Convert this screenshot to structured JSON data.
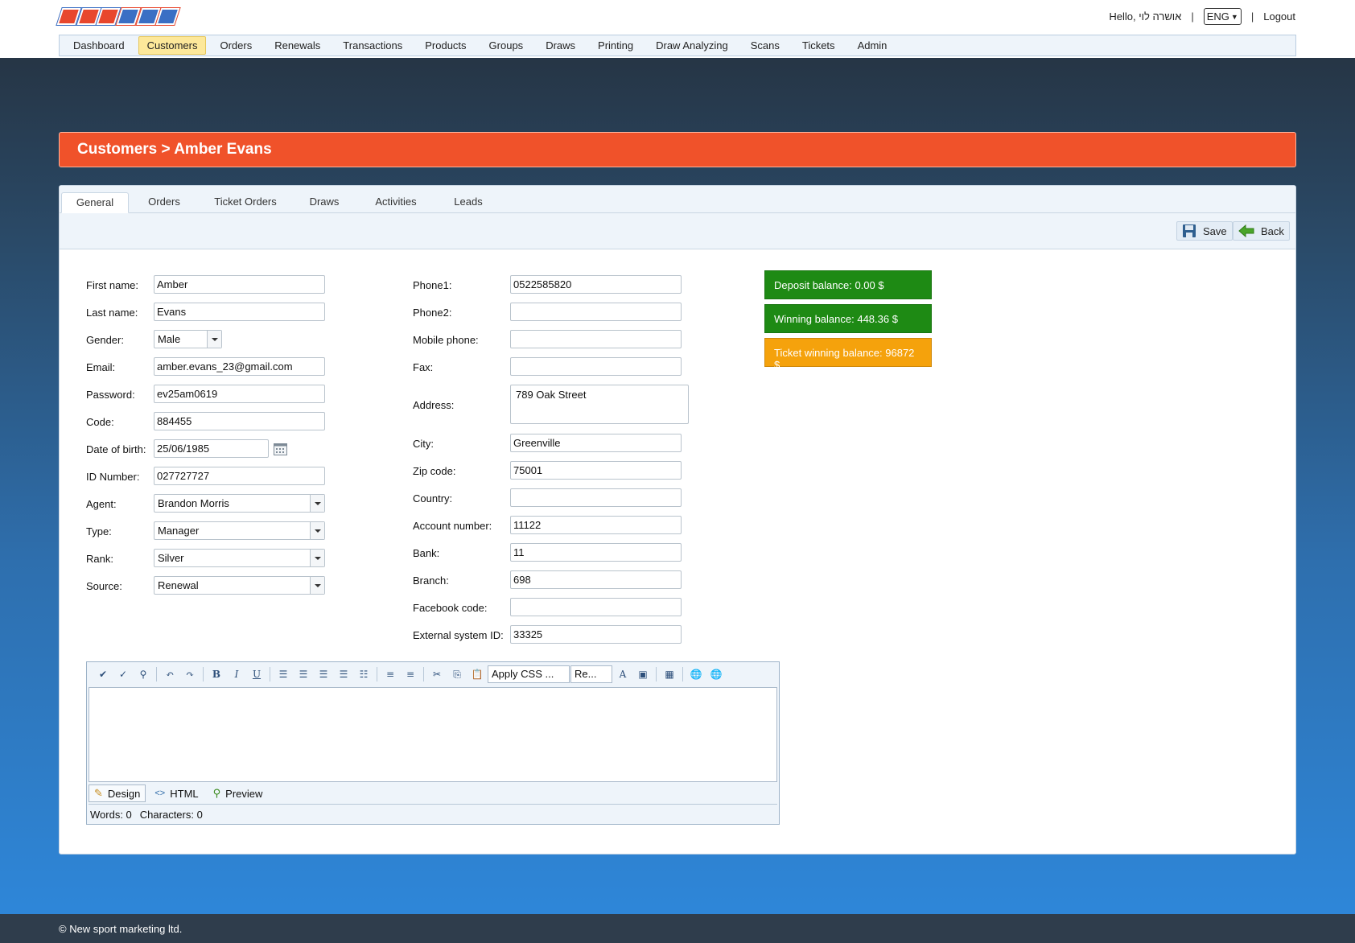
{
  "header": {
    "greeting": "Hello, אושרה לוי",
    "separator": "|",
    "language": "ENG",
    "logout": "Logout"
  },
  "nav": {
    "items": [
      "Dashboard",
      "Customers",
      "Orders",
      "Renewals",
      "Transactions",
      "Products",
      "Groups",
      "Draws",
      "Printing",
      "Draw Analyzing",
      "Scans",
      "Tickets",
      "Admin"
    ],
    "active": "Customers"
  },
  "page": {
    "title": "Customers > Amber Evans"
  },
  "tabs": {
    "items": [
      "General",
      "Orders",
      "Ticket Orders",
      "Draws",
      "Activities",
      "Leads"
    ],
    "active": "General"
  },
  "toolbar": {
    "save": "Save",
    "back": "Back"
  },
  "form": {
    "first_name": {
      "label": "First name:",
      "value": "Amber"
    },
    "last_name": {
      "label": "Last name:",
      "value": "Evans"
    },
    "gender": {
      "label": "Gender:",
      "value": "Male"
    },
    "email": {
      "label": "Email:",
      "value": "amber.evans_23@gmail.com"
    },
    "password": {
      "label": "Password:",
      "value": "ev25am0619"
    },
    "code": {
      "label": "Code:",
      "value": "884455"
    },
    "dob": {
      "label": "Date of birth:",
      "value": "25/06/1985"
    },
    "id_number": {
      "label": "ID Number:",
      "value": "027727727"
    },
    "agent": {
      "label": "Agent:",
      "value": "Brandon Morris"
    },
    "type": {
      "label": "Type:",
      "value": "Manager"
    },
    "rank": {
      "label": "Rank:",
      "value": "Silver"
    },
    "source": {
      "label": "Source:",
      "value": "Renewal"
    },
    "phone1": {
      "label": "Phone1:",
      "value": "0522585820"
    },
    "phone2": {
      "label": "Phone2:",
      "value": ""
    },
    "mobile": {
      "label": "Mobile phone:",
      "value": ""
    },
    "fax": {
      "label": "Fax:",
      "value": ""
    },
    "address": {
      "label": "Address:",
      "value": "789 Oak Street"
    },
    "city": {
      "label": "City:",
      "value": "Greenville"
    },
    "zip": {
      "label": "Zip code:",
      "value": "75001"
    },
    "country": {
      "label": "Country:",
      "value": ""
    },
    "account": {
      "label": "Account number:",
      "value": "11122"
    },
    "bank": {
      "label": "Bank:",
      "value": "11"
    },
    "branch": {
      "label": "Branch:",
      "value": "698"
    },
    "facebook": {
      "label": "Facebook code:",
      "value": ""
    },
    "external_id": {
      "label": "External system ID:",
      "value": "33325"
    }
  },
  "balances": {
    "deposit": {
      "text": "Deposit balance: 0.00 $",
      "color": "#1e8a14"
    },
    "winning": {
      "text": "Winning balance: 448.36 $",
      "color": "#1e8a14"
    },
    "ticket": {
      "text": "Ticket winning balance: 96872 $",
      "color": "#f5a20c"
    }
  },
  "editor": {
    "css_dropdown": "Apply CSS ...",
    "format_dropdown": "Re...",
    "modes": {
      "design": "Design",
      "html": "HTML",
      "preview": "Preview"
    },
    "words": "Words: 0",
    "characters": "Characters: 0"
  },
  "footer": {
    "copyright": "© New sport marketing ltd."
  }
}
